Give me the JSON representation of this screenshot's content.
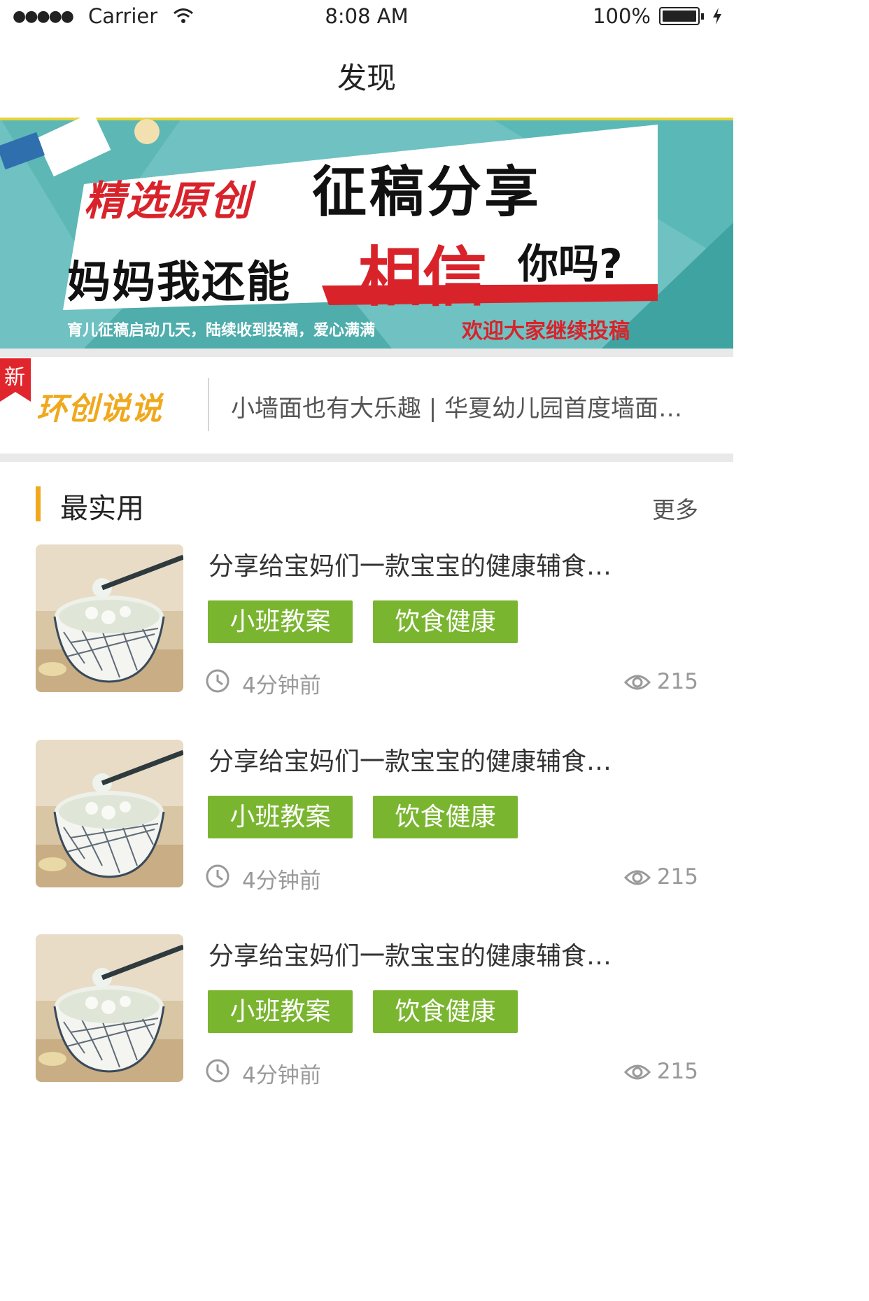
{
  "status_bar": {
    "signal": "●●●●●",
    "carrier": "Carrier",
    "time": "8:08 AM",
    "battery": "100%"
  },
  "nav": {
    "title": "发现"
  },
  "banner": {
    "slogan_red": "精选原创",
    "slogan_black": "征稿分享",
    "question_black": "妈妈我还能",
    "question_red": "相信",
    "question_end": "你吗?",
    "footer_left": "育儿征稿启动几天，陆续收到投稿，爱心满满",
    "footer_right": "欢迎大家继续投稿",
    "colors": {
      "teal": "#5ab9b6",
      "red": "#d9232b"
    }
  },
  "ticker": {
    "badge": "新",
    "logo": "环创说说",
    "headline": "小墙面也有大乐趣 | 华夏幼儿园首度墙面…"
  },
  "section": {
    "title": "最实用",
    "more": "更多",
    "accent": "#f0a81c"
  },
  "articles": [
    {
      "title": "分享给宝妈们一款宝宝的健康辅食…",
      "tags": [
        "小班教案",
        "饮食健康"
      ],
      "time": "4分钟前",
      "views": "215"
    },
    {
      "title": "分享给宝妈们一款宝宝的健康辅食…",
      "tags": [
        "小班教案",
        "饮食健康"
      ],
      "time": "4分钟前",
      "views": "215"
    },
    {
      "title": "分享给宝妈们一款宝宝的健康辅食…",
      "tags": [
        "小班教案",
        "饮食健康"
      ],
      "time": "4分钟前",
      "views": "215"
    }
  ],
  "icons": {
    "wifi": "wifi-icon",
    "battery": "battery-icon",
    "charging": "charging-icon",
    "clock": "clock-icon",
    "eye": "eye-icon"
  },
  "tag_color": "#7ab530"
}
